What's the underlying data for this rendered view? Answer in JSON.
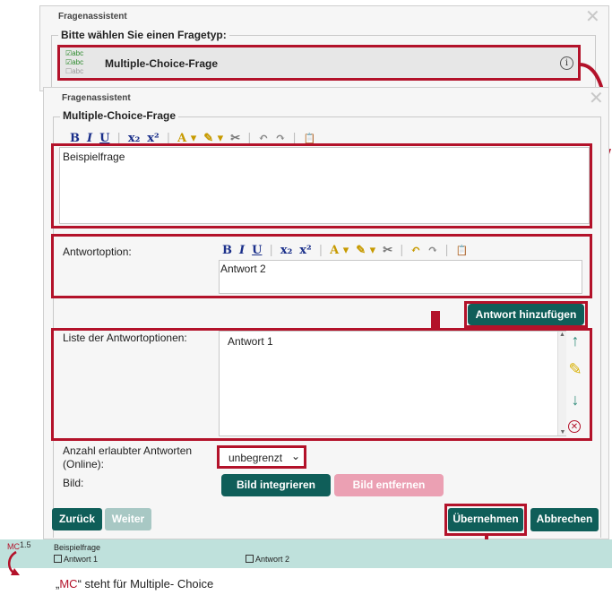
{
  "back_dialog": {
    "title": "Fragenassistent",
    "legend": "Bitte wählen Sie einen Fragetyp:",
    "question_type": {
      "label": "Multiple-Choice-Frage",
      "icon_lines": [
        "abc",
        "abc",
        "abc"
      ],
      "info": "i"
    }
  },
  "front_dialog": {
    "title": "Fragenassistent",
    "legend": "Multiple-Choice-Frage",
    "question_text": "Beispielfrage",
    "answer_option_label": "Antwortoption:",
    "answer_option_value": "Antwort 2",
    "add_answer_button": "Antwort hinzufügen",
    "list_label": "Liste der Antwortoptionen:",
    "list_items": [
      "Antwort 1"
    ],
    "allowed_answers_label": "Anzahl erlaubter Antworten (Online):",
    "allowed_answers_value": "unbegrenzt",
    "image_label": "Bild:",
    "image_insert_button": "Bild integrieren",
    "image_remove_button": "Bild entfernen",
    "back_button": "Zurück",
    "next_button": "Weiter",
    "apply_button": "Übernehmen",
    "cancel_button": "Abbrechen"
  },
  "toolbar": [
    "B",
    "I",
    "U",
    "x₂",
    "x²",
    "A ▾",
    "✎ ▾",
    "✂",
    "↶",
    "↷",
    "📋"
  ],
  "preview": {
    "code": "MC",
    "number": "1.5",
    "question": "Beispielfrage",
    "options": [
      "Antwort 1",
      "Antwort 2"
    ]
  },
  "caption": {
    "open_quote": "„",
    "code": "MC",
    "close_text": "“ steht für Multiple- Choice"
  },
  "colors": {
    "teal": "#0f5e59",
    "red_frame": "#b3122a",
    "pink": "#eba0b3",
    "preview_bg": "#bfe1dc"
  }
}
